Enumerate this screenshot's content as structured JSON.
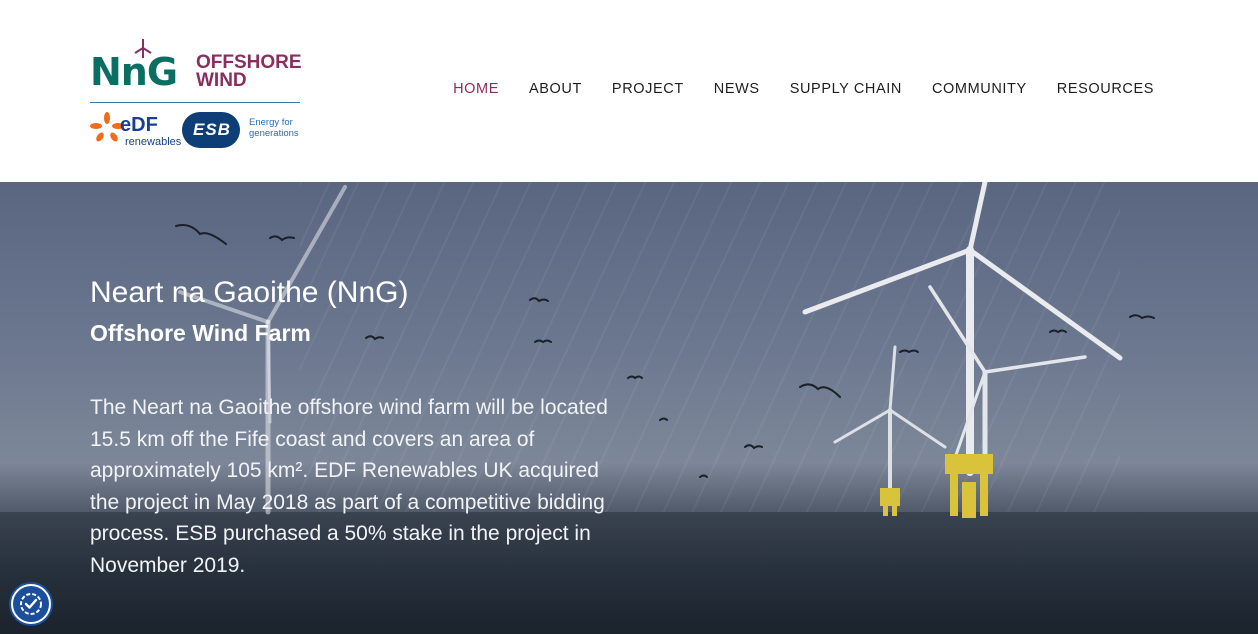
{
  "logo": {
    "brand_mark": "NnG",
    "brand_line1": "OFFSHORE",
    "brand_line2": "WIND",
    "partner1": "eDF",
    "partner1_sub": "renewables",
    "partner2": "ESB",
    "partner2_tag_line1": "Energy for",
    "partner2_tag_line2": "generations",
    "colors": {
      "green": "#0b6e62",
      "maroon": "#8a2e5f",
      "edf_blue": "#1a3f8f",
      "esb_blue": "#0d3e78"
    }
  },
  "nav": {
    "items": [
      {
        "label": "HOME",
        "active": true
      },
      {
        "label": "ABOUT",
        "active": false
      },
      {
        "label": "PROJECT",
        "active": false
      },
      {
        "label": "NEWS",
        "active": false
      },
      {
        "label": "SUPPLY CHAIN",
        "active": false
      },
      {
        "label": "COMMUNITY",
        "active": false
      },
      {
        "label": "RESOURCES",
        "active": false
      }
    ],
    "active_color": "#8a2e5f"
  },
  "hero": {
    "title": "Neart na Gaoithe (NnG)",
    "subtitle": "Offshore Wind Farm",
    "body": "The Neart na Gaoithe offshore wind farm will be located 15.5 km off the Fife coast and covers an area of approximately 105 km². EDF Renewables UK acquired the project in May 2018 as part of a competitive bidding process. ESB purchased a 50% stake in the project in November 2019.",
    "background_image": "offshore-wind-turbines-with-birds-over-sea"
  },
  "accessibility_button": {
    "icon": "accessibility-checkmark-icon"
  }
}
